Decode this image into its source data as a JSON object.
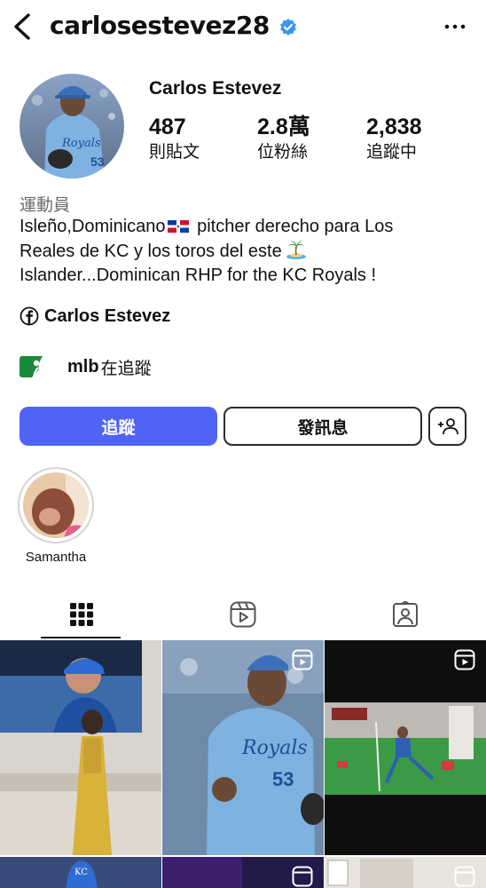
{
  "header": {
    "username": "carlosestevez28",
    "verified": true,
    "icons": {
      "back": "chevron-left-icon",
      "more": "more-horizontal-icon"
    }
  },
  "profile": {
    "display_name": "Carlos Estevez",
    "stats": [
      {
        "value": "487",
        "label": "則貼文"
      },
      {
        "value": "2.8萬",
        "label": "位粉絲"
      },
      {
        "value": "2,838",
        "label": "追蹤中"
      }
    ],
    "category": "運動員",
    "bio_lines": [
      "Isleño,Dominicano",
      "pitcher derecho para Los",
      "Reales de KC y los toros del este",
      "Islander...Dominican RHP for the KC Royals !"
    ],
    "facebook_link": "Carlos Estevez",
    "followed_by": {
      "name": "mlb",
      "suffix": "在追蹤"
    }
  },
  "actions": {
    "follow_label": "追蹤",
    "message_label": "發訊息"
  },
  "highlights": [
    {
      "label": "Samantha"
    }
  ],
  "colors": {
    "accent": "#4f63f6",
    "verified": "#3897f0",
    "royals_blue": "#7fb2e0"
  }
}
